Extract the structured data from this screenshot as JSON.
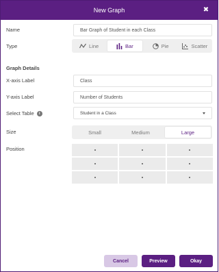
{
  "dialog": {
    "title": "New Graph",
    "close_glyph": "✖"
  },
  "form": {
    "name_label": "Name",
    "name_value": "Bar Graph of Student in each Class",
    "type_label": "Type",
    "types": [
      {
        "label": "Line",
        "icon": "line-chart-icon",
        "active": false
      },
      {
        "label": "Bar",
        "icon": "bar-chart-icon",
        "active": true
      },
      {
        "label": "Pie",
        "icon": "pie-chart-icon",
        "active": false
      },
      {
        "label": "Scatter",
        "icon": "scatter-chart-icon",
        "active": false
      }
    ],
    "details_title": "Graph Details",
    "xaxis_label": "X-axis Label",
    "xaxis_value": "Class",
    "yaxis_label": "Y-axis Label",
    "yaxis_value": "Number of Students",
    "table_label": "Select Table",
    "table_info_glyph": "i",
    "table_value": "Student in a Class",
    "size_label": "Size",
    "sizes": [
      {
        "label": "Small",
        "active": false
      },
      {
        "label": "Medium",
        "active": false
      },
      {
        "label": "Large",
        "active": true
      }
    ],
    "position_label": "Position",
    "position_cells": 9
  },
  "actions": {
    "cancel": "Cancel",
    "preview": "Preview",
    "okay": "Okay"
  },
  "colors": {
    "accent": "#5b1f82",
    "cancel_bg": "#d8c8e5",
    "segment_bg": "#efefef",
    "grid_cell_bg": "#ebebeb"
  }
}
